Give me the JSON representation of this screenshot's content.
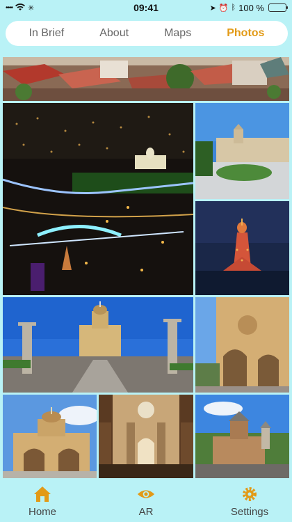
{
  "status_bar": {
    "carrier_signal": "••••",
    "time": "09:41",
    "battery_pct": "100 %",
    "battery_level": 1.0
  },
  "tabs": [
    {
      "label": "In Brief",
      "active": false
    },
    {
      "label": "About",
      "active": false
    },
    {
      "label": "Maps",
      "active": false
    },
    {
      "label": "Photos",
      "active": true
    }
  ],
  "photos": [
    {
      "subject": "city-rooftops"
    },
    {
      "subject": "night-city-bridge"
    },
    {
      "subject": "palace-garden"
    },
    {
      "subject": "cathedral-night"
    },
    {
      "subject": "cathedral-crosses"
    },
    {
      "subject": "cathedral-facade"
    },
    {
      "subject": "cathedral-dome"
    },
    {
      "subject": "cathedral-interior"
    },
    {
      "subject": "old-church"
    }
  ],
  "bottom_nav": {
    "home_label": "Home",
    "ar_label": "AR",
    "settings_label": "Settings"
  },
  "colors": {
    "accent": "#e29a17",
    "background": "#b9f2f6",
    "tab_inactive": "#666666"
  }
}
